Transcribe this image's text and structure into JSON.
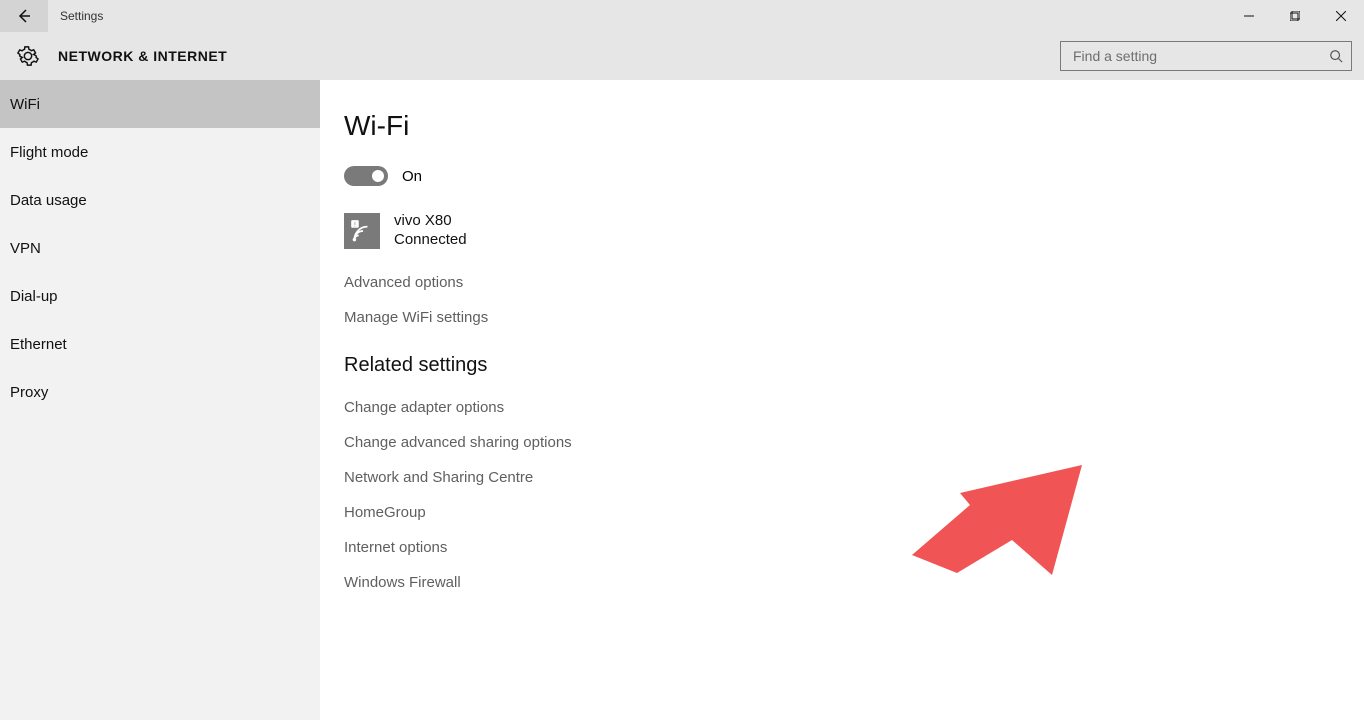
{
  "window": {
    "title": "Settings"
  },
  "header": {
    "category": "NETWORK & INTERNET",
    "search_placeholder": "Find a setting"
  },
  "sidebar": {
    "items": [
      {
        "label": "WiFi",
        "selected": true
      },
      {
        "label": "Flight mode",
        "selected": false
      },
      {
        "label": "Data usage",
        "selected": false
      },
      {
        "label": "VPN",
        "selected": false
      },
      {
        "label": "Dial-up",
        "selected": false
      },
      {
        "label": "Ethernet",
        "selected": false
      },
      {
        "label": "Proxy",
        "selected": false
      }
    ]
  },
  "main": {
    "heading": "Wi-Fi",
    "toggle": {
      "state_label": "On",
      "value": true
    },
    "current_network": {
      "name": "vivo X80",
      "status": "Connected"
    },
    "wifi_links": [
      "Advanced options",
      "Manage WiFi settings"
    ],
    "related_heading": "Related settings",
    "related_links": [
      "Change adapter options",
      "Change advanced sharing options",
      "Network and Sharing Centre",
      "HomeGroup",
      "Internet options",
      "Windows Firewall"
    ]
  },
  "annotation": {
    "arrow_color": "#f05454",
    "points_to": "Change advanced sharing options"
  }
}
